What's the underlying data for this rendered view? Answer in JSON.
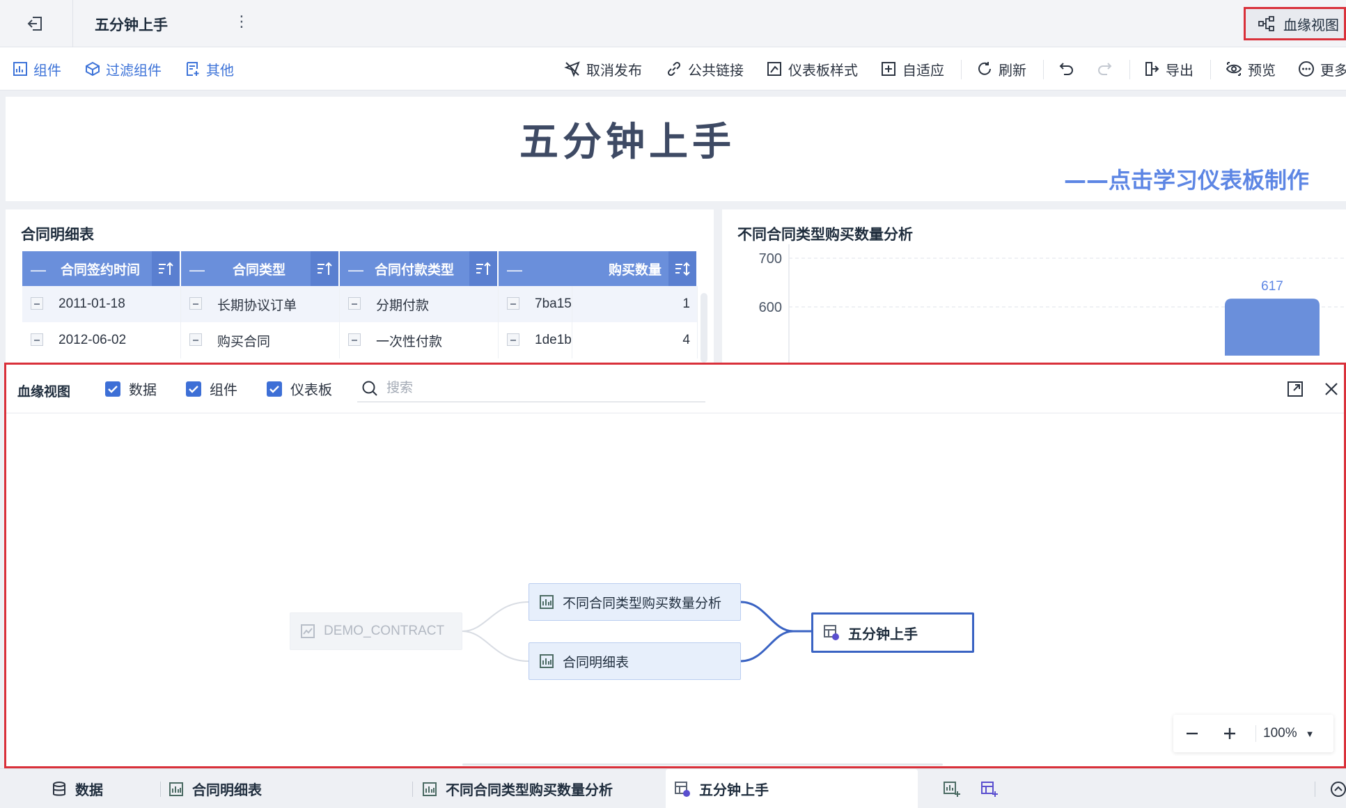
{
  "header": {
    "title": "五分钟上手",
    "lineage_button": "血缘视图"
  },
  "toolbar": {
    "left": [
      {
        "label": "组件",
        "icon": "component-icon"
      },
      {
        "label": "过滤组件",
        "icon": "filter-component-icon"
      },
      {
        "label": "其他",
        "icon": "other-icon"
      }
    ],
    "right": [
      {
        "label": "取消发布",
        "icon": "unpublish-icon"
      },
      {
        "label": "公共链接",
        "icon": "link-icon"
      },
      {
        "label": "仪表板样式",
        "icon": "dashboard-style-icon"
      },
      {
        "label": "自适应",
        "icon": "adaptive-icon"
      },
      {
        "label": "刷新",
        "icon": "refresh-icon"
      },
      {
        "label": "导出",
        "icon": "export-icon"
      },
      {
        "label": "预览",
        "icon": "preview-icon"
      },
      {
        "label": "更多",
        "icon": "more-icon"
      }
    ]
  },
  "dashboard": {
    "hero_title": "五分钟上手",
    "hero_subtitle": "——点击学习仪表板制作",
    "table": {
      "title": "合同明细表",
      "columns": [
        "合同签约时间",
        "合同类型",
        "合同付款类型",
        "购买数量"
      ],
      "rows": [
        [
          "2011-01-18",
          "长期协议订单",
          "分期付款",
          "7ba15",
          "1"
        ],
        [
          "2012-06-02",
          "购买合同",
          "一次性付款",
          "1de1b",
          "4"
        ]
      ]
    },
    "chart": {
      "title": "不同合同类型购买数量分析"
    }
  },
  "chart_data": {
    "type": "bar",
    "title": "不同合同类型购买数量分析",
    "categories": [
      ""
    ],
    "values": [
      617
    ],
    "data_labels": [
      "617"
    ],
    "yticks": [
      "700",
      "600"
    ],
    "ylim": [
      500,
      720
    ],
    "grid": true
  },
  "lineage": {
    "title": "血缘视图",
    "filters": [
      {
        "label": "数据",
        "checked": true
      },
      {
        "label": "组件",
        "checked": true
      },
      {
        "label": "仪表板",
        "checked": true
      }
    ],
    "search_placeholder": "搜索",
    "nodes": {
      "source": "DEMO_CONTRACT",
      "widget_1": "不同合同类型购买数量分析",
      "widget_2": "合同明细表",
      "dashboard": "五分钟上手"
    },
    "zoom": "100%"
  },
  "bottom_tabs": [
    {
      "label": "数据",
      "icon": "database-icon"
    },
    {
      "label": "合同明细表",
      "icon": "table-widget-icon"
    },
    {
      "label": "不同合同类型购买数量分析",
      "icon": "table-widget-icon"
    },
    {
      "label": "五分钟上手",
      "icon": "dashboard-tab-icon",
      "active": true
    }
  ],
  "colors": {
    "accent": "#3d6fd6",
    "highlight_border": "#d9303a",
    "bar": "#6a8fdb",
    "table_header": "#6a8fdb"
  }
}
